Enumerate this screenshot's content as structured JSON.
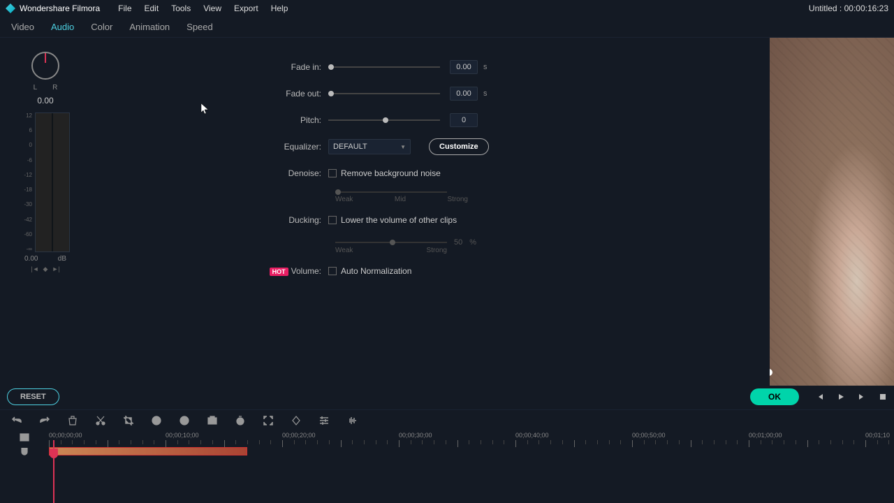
{
  "app": {
    "name": "Wondershare Filmora"
  },
  "menu": {
    "file": "File",
    "edit": "Edit",
    "tools": "Tools",
    "view": "View",
    "export": "Export",
    "help": "Help"
  },
  "title_right": "Untitled : 00:00:16:23",
  "tabs": {
    "video": "Video",
    "audio": "Audio",
    "color": "Color",
    "animation": "Animation",
    "speed": "Speed"
  },
  "pan": {
    "l": "L",
    "r": "R",
    "value": "0.00"
  },
  "vu": {
    "ticks": [
      "12",
      "6",
      "0",
      "-6",
      "-12",
      "-18",
      "-30",
      "-42",
      "-60",
      "-∞"
    ],
    "bottom_l": "0.00",
    "bottom_r": "dB",
    "marks": [
      "|◄",
      "◆",
      "►|"
    ]
  },
  "settings": {
    "fadein": {
      "label": "Fade in:",
      "value": "0.00",
      "unit": "s"
    },
    "fadeout": {
      "label": "Fade out:",
      "value": "0.00",
      "unit": "s"
    },
    "pitch": {
      "label": "Pitch:",
      "value": "0"
    },
    "equalizer": {
      "label": "Equalizer:",
      "selected": "DEFAULT",
      "customize": "Customize"
    },
    "denoise": {
      "label": "Denoise:",
      "checkbox": "Remove background noise",
      "weak": "Weak",
      "mid": "Mid",
      "strong": "Strong"
    },
    "ducking": {
      "label": "Ducking:",
      "checkbox": "Lower the volume of other clips",
      "weak": "Weak",
      "strong": "Strong",
      "val": "50",
      "unit": "%"
    },
    "volume": {
      "badge": "HOT",
      "label": "Volume:",
      "checkbox": "Auto Normalization"
    }
  },
  "buttons": {
    "reset": "RESET",
    "ok": "OK"
  },
  "timeline": {
    "ticks": [
      "00;00;00;00",
      "00;00;10;00",
      "00;00;20;00",
      "00;00;30;00",
      "00;00;40;00",
      "00;00;50;00",
      "00;01;00;00",
      "00;01;10"
    ]
  }
}
